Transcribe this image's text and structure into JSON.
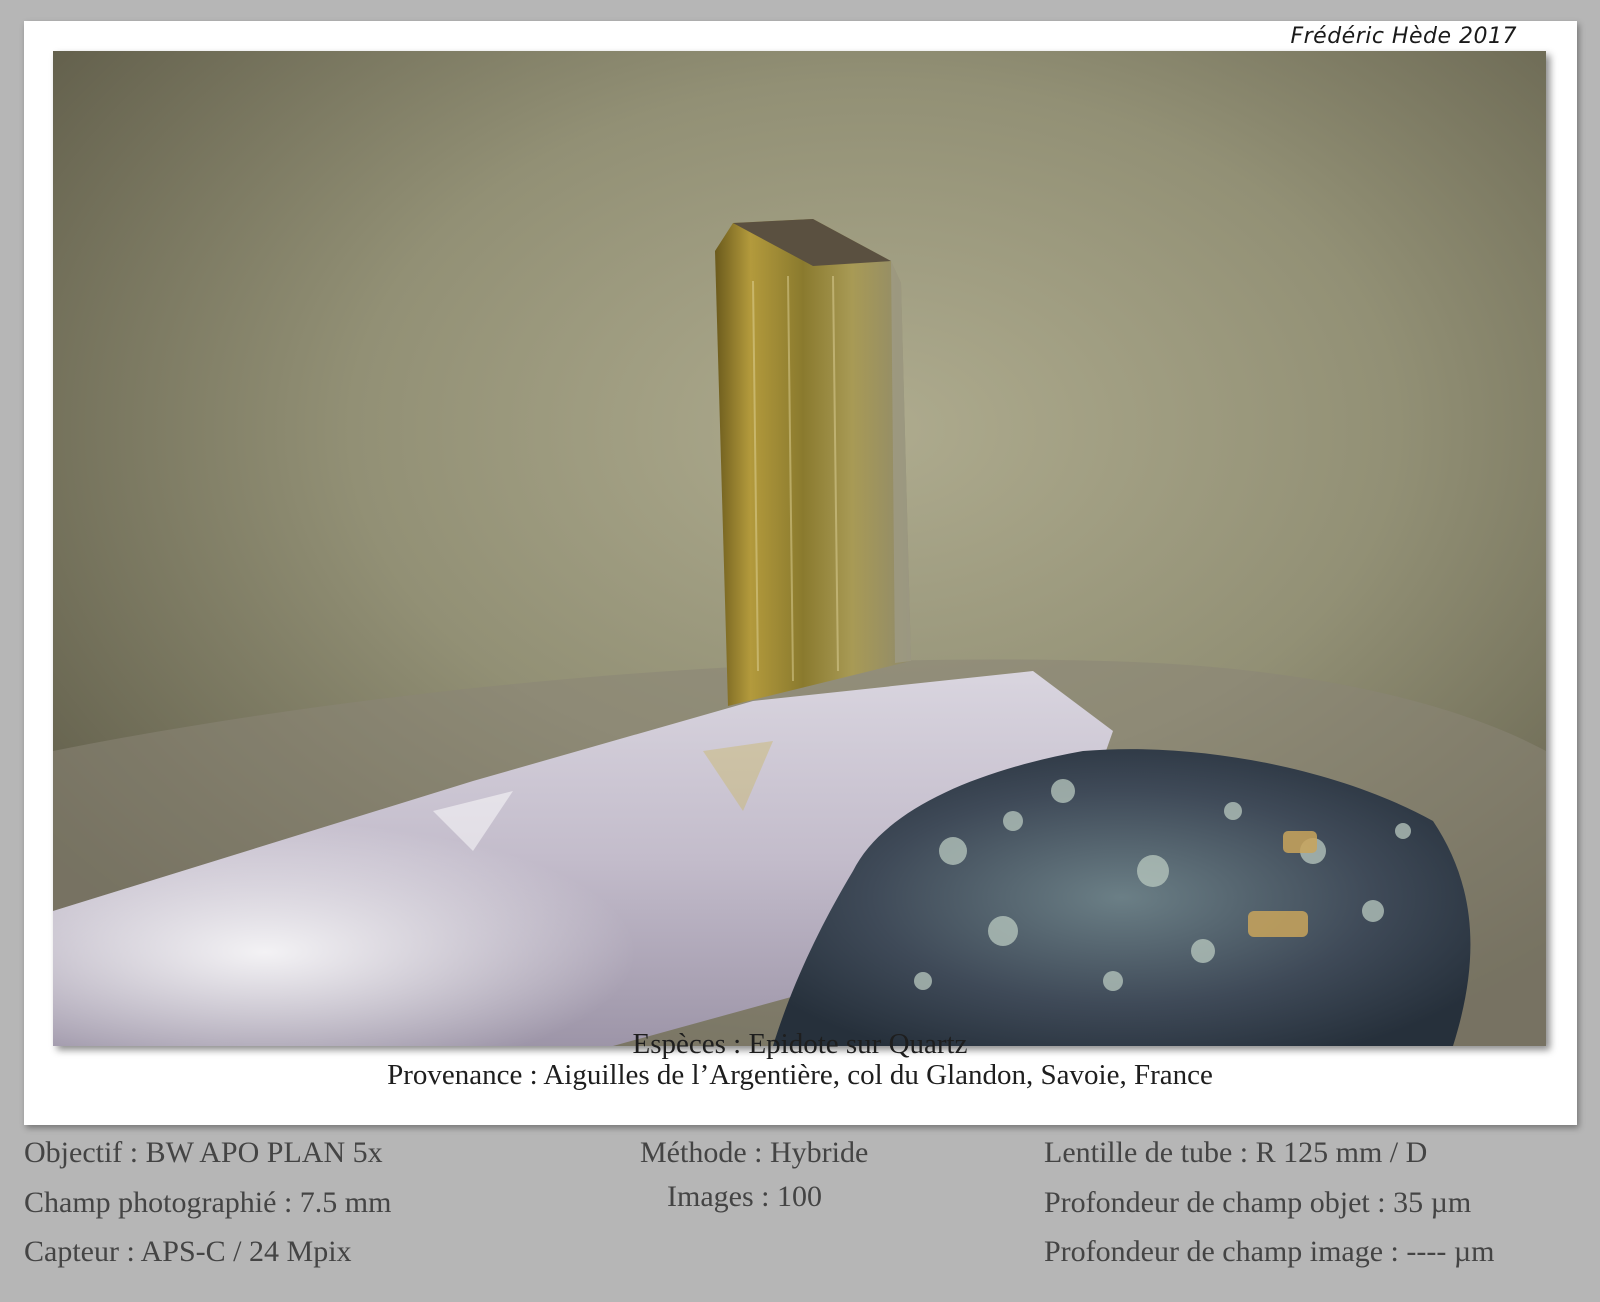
{
  "signature": "Frédéric Hède 2017",
  "photo": {
    "subject": "epidote-crystal-on-quartz"
  },
  "caption": {
    "species": "Espèces : Epidote sur Quartz",
    "provenance": "Provenance : Aiguilles de l’Argentière, col du Glandon, Savoie, France"
  },
  "specs": {
    "left": [
      "Objectif : BW APO PLAN 5x",
      "Champ photographié : 7.5 mm",
      "Capteur : APS-C / 24 Mpix"
    ],
    "middle": [
      "Méthode : Hybride",
      "Images : 100"
    ],
    "right": [
      "Lentille de tube : R 125 mm / D",
      "Profondeur de champ objet : 35 µm",
      "Profondeur de champ image : ---- µm"
    ]
  },
  "colors": {
    "background": "#b6b6b6",
    "frame": "#ffffff",
    "spec_text": "#444444",
    "caption_text": "#1e1e1e"
  }
}
